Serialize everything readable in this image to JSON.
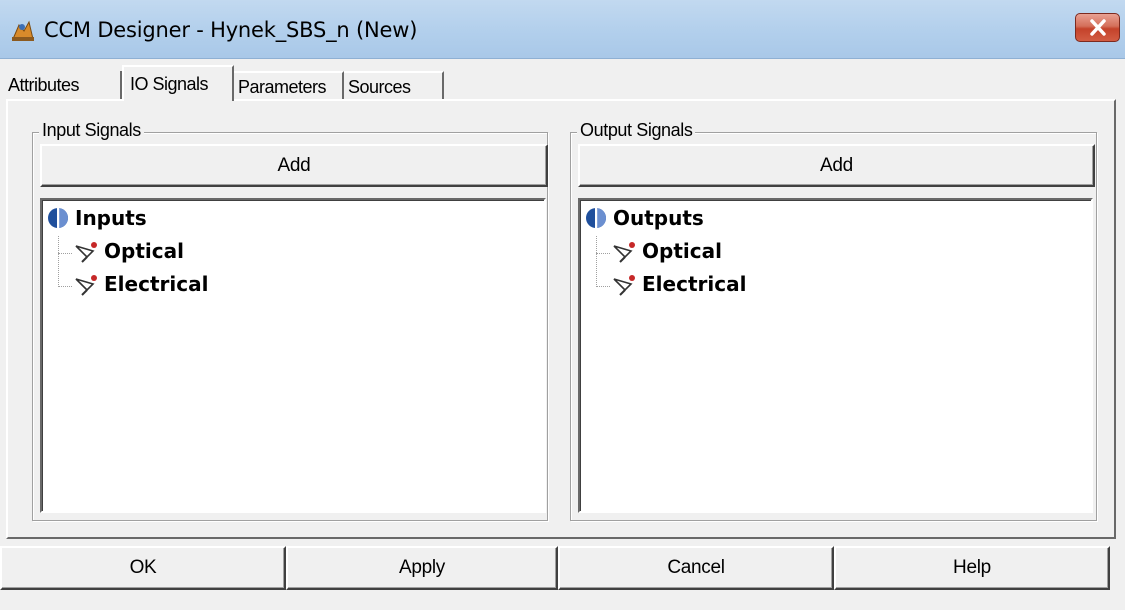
{
  "window": {
    "title": "CCM Designer - Hynek_SBS_n (New)",
    "app_icon": "ccm-designer-app-icon",
    "close_icon": "close-icon"
  },
  "tabs": [
    {
      "label": "Attributes",
      "active": false
    },
    {
      "label": "IO Signals",
      "active": true
    },
    {
      "label": "Parameters",
      "active": false
    },
    {
      "label": "Sources",
      "active": false
    }
  ],
  "input_group": {
    "legend": "Input Signals",
    "add_label": "Add",
    "tree": {
      "root": "Inputs",
      "root_icon": "signal-group-icon",
      "children": [
        "Optical",
        "Electrical"
      ],
      "child_icon": "probe-icon"
    }
  },
  "output_group": {
    "legend": "Output Signals",
    "add_label": "Add",
    "tree": {
      "root": "Outputs",
      "root_icon": "signal-group-icon",
      "children": [
        "Optical",
        "Electrical"
      ],
      "child_icon": "probe-icon"
    }
  },
  "footer": {
    "ok": "OK",
    "apply": "Apply",
    "cancel": "Cancel",
    "help": "Help"
  }
}
